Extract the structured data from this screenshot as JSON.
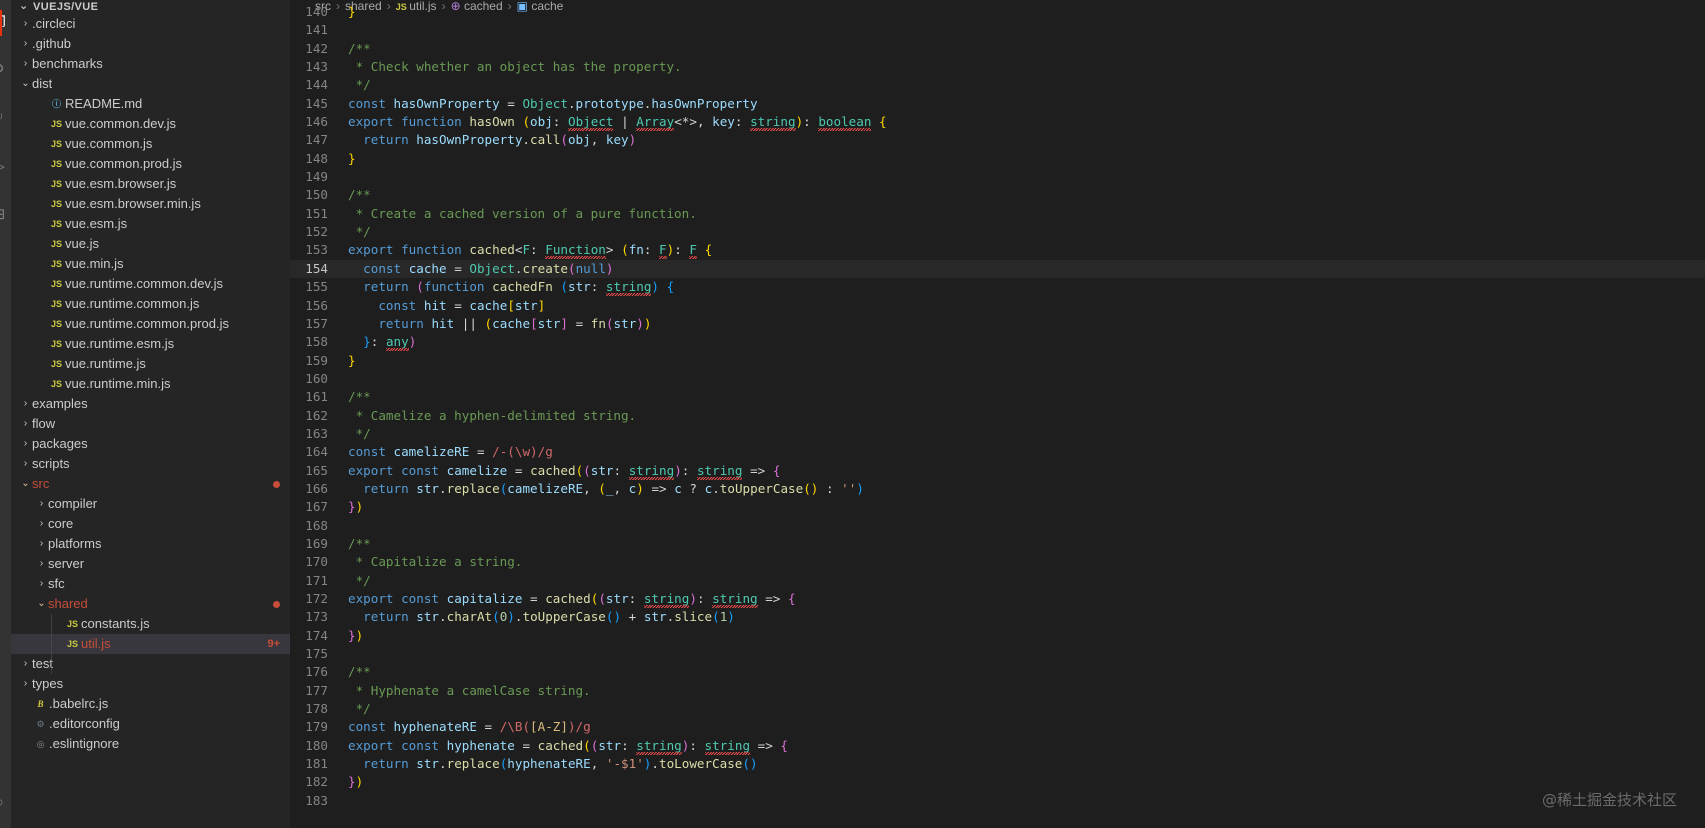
{
  "activity_bar": {
    "items": [
      {
        "name": "explorer-icon",
        "glyph": "❐",
        "active": true
      },
      {
        "name": "search-icon",
        "glyph": "⚲",
        "active": false
      },
      {
        "name": "source-control-icon",
        "glyph": "⑂",
        "active": false
      },
      {
        "name": "run-debug-icon",
        "glyph": "▷",
        "active": false
      },
      {
        "name": "extensions-icon",
        "glyph": "⊞",
        "active": false
      },
      {
        "name": "accounts-icon",
        "glyph": "○",
        "active": false
      }
    ]
  },
  "sidebar": {
    "title": "VUEJS/VUE",
    "title_twisty": "⌄",
    "items": [
      {
        "label": ".circleci",
        "kind": "folder",
        "twisty": "›",
        "indent": 1
      },
      {
        "label": ".github",
        "kind": "folder",
        "twisty": "›",
        "indent": 1
      },
      {
        "label": "benchmarks",
        "kind": "folder",
        "twisty": "›",
        "indent": 1
      },
      {
        "label": "dist",
        "kind": "folder",
        "twisty": "⌄",
        "indent": 1,
        "expanded": true
      },
      {
        "label": "README.md",
        "kind": "md",
        "icon": "ⓘ",
        "indent": 2
      },
      {
        "label": "vue.common.dev.js",
        "kind": "js",
        "icon": "JS",
        "indent": 2
      },
      {
        "label": "vue.common.js",
        "kind": "js",
        "icon": "JS",
        "indent": 2
      },
      {
        "label": "vue.common.prod.js",
        "kind": "js",
        "icon": "JS",
        "indent": 2
      },
      {
        "label": "vue.esm.browser.js",
        "kind": "js",
        "icon": "JS",
        "indent": 2
      },
      {
        "label": "vue.esm.browser.min.js",
        "kind": "js",
        "icon": "JS",
        "indent": 2
      },
      {
        "label": "vue.esm.js",
        "kind": "js",
        "icon": "JS",
        "indent": 2
      },
      {
        "label": "vue.js",
        "kind": "js",
        "icon": "JS",
        "indent": 2
      },
      {
        "label": "vue.min.js",
        "kind": "js",
        "icon": "JS",
        "indent": 2
      },
      {
        "label": "vue.runtime.common.dev.js",
        "kind": "js",
        "icon": "JS",
        "indent": 2
      },
      {
        "label": "vue.runtime.common.js",
        "kind": "js",
        "icon": "JS",
        "indent": 2
      },
      {
        "label": "vue.runtime.common.prod.js",
        "kind": "js",
        "icon": "JS",
        "indent": 2
      },
      {
        "label": "vue.runtime.esm.js",
        "kind": "js",
        "icon": "JS",
        "indent": 2
      },
      {
        "label": "vue.runtime.js",
        "kind": "js",
        "icon": "JS",
        "indent": 2
      },
      {
        "label": "vue.runtime.min.js",
        "kind": "js",
        "icon": "JS",
        "indent": 2
      },
      {
        "label": "examples",
        "kind": "folder",
        "twisty": "›",
        "indent": 1
      },
      {
        "label": "flow",
        "kind": "folder",
        "twisty": "›",
        "indent": 1
      },
      {
        "label": "packages",
        "kind": "folder",
        "twisty": "›",
        "indent": 1
      },
      {
        "label": "scripts",
        "kind": "folder",
        "twisty": "›",
        "indent": 1
      },
      {
        "label": "src",
        "kind": "folder",
        "twisty": "⌄",
        "indent": 1,
        "expanded": true,
        "state": "modified",
        "dot": true
      },
      {
        "label": "compiler",
        "kind": "folder",
        "twisty": "›",
        "indent": 2
      },
      {
        "label": "core",
        "kind": "folder",
        "twisty": "›",
        "indent": 2
      },
      {
        "label": "platforms",
        "kind": "folder",
        "twisty": "›",
        "indent": 2
      },
      {
        "label": "server",
        "kind": "folder",
        "twisty": "›",
        "indent": 2
      },
      {
        "label": "sfc",
        "kind": "folder",
        "twisty": "›",
        "indent": 2
      },
      {
        "label": "shared",
        "kind": "folder",
        "twisty": "⌄",
        "indent": 2,
        "expanded": true,
        "state": "modified",
        "dot": true
      },
      {
        "label": "constants.js",
        "kind": "js",
        "icon": "JS",
        "indent": 3
      },
      {
        "label": "util.js",
        "kind": "js",
        "icon": "JS",
        "indent": 3,
        "selected": true,
        "state": "modified",
        "badge": "9+"
      },
      {
        "label": "test",
        "kind": "folder",
        "twisty": "›",
        "indent": 1
      },
      {
        "label": "types",
        "kind": "folder",
        "twisty": "›",
        "indent": 1
      },
      {
        "label": ".babelrc.js",
        "kind": "babel",
        "icon": "B",
        "indent": 1
      },
      {
        "label": ".editorconfig",
        "kind": "gear",
        "icon": "⚙",
        "indent": 1
      },
      {
        "label": ".eslintignore",
        "kind": "circle",
        "icon": "◎",
        "indent": 1
      }
    ]
  },
  "breadcrumb": {
    "segments": [
      {
        "text": "src",
        "icon": ""
      },
      {
        "text": "shared",
        "icon": ""
      },
      {
        "text": "util.js",
        "icon": "JS"
      },
      {
        "text": "cached",
        "icon": "⊕"
      },
      {
        "text": "cache",
        "icon": "▣"
      }
    ],
    "separator": "›"
  },
  "editor": {
    "first_visible_line": 140,
    "current_line": 154,
    "watermark": "@稀土掘金技术社区",
    "lines": [
      {
        "n": 140,
        "clipped": true,
        "html": "<span class='pu1'>}</span>"
      },
      {
        "n": 141,
        "html": ""
      },
      {
        "n": 142,
        "html": "<span class='cmt'>/**</span>"
      },
      {
        "n": 143,
        "html": "<span class='cmt'> * Check whether an object has the property.</span>"
      },
      {
        "n": 144,
        "html": "<span class='cmt'> */</span>"
      },
      {
        "n": 145,
        "html": "<span class='kw'>const</span> <span class='var'>hasOwnProperty</span> <span class='op'>=</span> <span class='typ'>Object</span><span class='op'>.</span><span class='var'>prototype</span><span class='op'>.</span><span class='var'>hasOwnProperty</span>"
      },
      {
        "n": 146,
        "html": "<span class='kw'>export</span> <span class='kw'>function</span> <span class='fn'>hasOwn</span> <span class='pu1'>(</span><span class='var'>obj</span><span class='op'>:</span> <span class='typ sq'>Object</span> <span class='op'>|</span> <span class='typ sq'>Array</span><span class='op'>&lt;*&gt;</span><span class='op'>,</span> <span class='var'>key</span><span class='op'>:</span> <span class='typ sq'>string</span><span class='pu1'>)</span><span class='op'>:</span> <span class='typ sq'>boolean</span> <span class='pu1'>{</span>"
      },
      {
        "n": 147,
        "html": "  <span class='kw'>return</span> <span class='var'>hasOwnProperty</span><span class='op'>.</span><span class='fn'>call</span><span class='pu2'>(</span><span class='var'>obj</span><span class='op'>,</span> <span class='var'>key</span><span class='pu2'>)</span>"
      },
      {
        "n": 148,
        "html": "<span class='pu1'>}</span>"
      },
      {
        "n": 149,
        "html": ""
      },
      {
        "n": 150,
        "html": "<span class='cmt'>/**</span>"
      },
      {
        "n": 151,
        "html": "<span class='cmt'> * Create a cached version of a pure function.</span>"
      },
      {
        "n": 152,
        "html": "<span class='cmt'> */</span>"
      },
      {
        "n": 153,
        "html": "<span class='kw'>export</span> <span class='kw'>function</span> <span class='fn'>cached</span><span class='op'>&lt;</span><span class='typ'>F</span><span class='op'>:</span> <span class='typ sq'>Function</span><span class='op'>&gt;</span> <span class='pu1'>(</span><span class='var'>fn</span><span class='op'>:</span> <span class='typ sq'>F</span><span class='pu1'>)</span><span class='op'>:</span> <span class='typ sq'>F</span> <span class='pu1'>{</span>"
      },
      {
        "n": 154,
        "current": true,
        "html": "  <span class='kw'>const</span> <span class='var'>cache</span> <span class='op'>=</span> <span class='typ'>Object</span><span class='op'>.</span><span class='fn'>create</span><span class='pu2'>(</span><span class='kw'>null</span><span class='pu2'>)</span>"
      },
      {
        "n": 155,
        "html": "  <span class='kw'>return</span> <span class='pu2'>(</span><span class='kw'>function</span> <span class='fn'>cachedFn</span> <span class='pu3'>(</span><span class='var'>str</span><span class='op'>:</span> <span class='typ sq'>string</span><span class='pu3'>)</span> <span class='pu3'>{</span>"
      },
      {
        "n": 156,
        "html": "    <span class='kw'>const</span> <span class='var'>hit</span> <span class='op'>=</span> <span class='var'>cache</span><span class='pu1'>[</span><span class='var'>str</span><span class='pu1'>]</span>"
      },
      {
        "n": 157,
        "html": "    <span class='kw'>return</span> <span class='var'>hit</span> <span class='op'>||</span> <span class='pu1'>(</span><span class='var'>cache</span><span class='pu2'>[</span><span class='var'>str</span><span class='pu2'>]</span> <span class='op'>=</span> <span class='fn'>fn</span><span class='pu2'>(</span><span class='var'>str</span><span class='pu2'>)</span><span class='pu1'>)</span>"
      },
      {
        "n": 158,
        "html": "  <span class='pu3'>}</span><span class='op'>:</span> <span class='typ sq'>any</span><span class='pu2'>)</span>"
      },
      {
        "n": 159,
        "html": "<span class='pu1'>}</span>"
      },
      {
        "n": 160,
        "html": ""
      },
      {
        "n": 161,
        "html": "<span class='cmt'>/**</span>"
      },
      {
        "n": 162,
        "html": "<span class='cmt'> * Camelize a hyphen-delimited string.</span>"
      },
      {
        "n": 163,
        "html": "<span class='cmt'> */</span>"
      },
      {
        "n": 164,
        "html": "<span class='kw'>const</span> <span class='var'>camelizeRE</span> <span class='op'>=</span> <span class='re'>/-(\\w)/g</span>"
      },
      {
        "n": 165,
        "html": "<span class='kw'>export</span> <span class='kw'>const</span> <span class='var'>camelize</span> <span class='op'>=</span> <span class='fn'>cached</span><span class='pu1'>(</span><span class='pu2'>(</span><span class='var'>str</span><span class='op'>:</span> <span class='typ sq'>string</span><span class='pu2'>)</span><span class='op'>:</span> <span class='typ sq'>string</span> <span class='op'>=&gt;</span> <span class='pu2'>{</span>"
      },
      {
        "n": 166,
        "html": "  <span class='kw'>return</span> <span class='var'>str</span><span class='op'>.</span><span class='fn'>replace</span><span class='pu3'>(</span><span class='var'>camelizeRE</span><span class='op'>,</span> <span class='pu1'>(</span><span class='var'>_</span><span class='op'>,</span> <span class='var'>c</span><span class='pu1'>)</span> <span class='op'>=&gt;</span> <span class='var'>c</span> <span class='op'>?</span> <span class='var'>c</span><span class='op'>.</span><span class='fn'>toUpperCase</span><span class='pu1'>()</span> <span class='op'>:</span> <span class='str'>''</span><span class='pu3'>)</span>"
      },
      {
        "n": 167,
        "html": "<span class='pu2'>}</span><span class='pu1'>)</span>"
      },
      {
        "n": 168,
        "html": ""
      },
      {
        "n": 169,
        "html": "<span class='cmt'>/**</span>"
      },
      {
        "n": 170,
        "html": "<span class='cmt'> * Capitalize a string.</span>"
      },
      {
        "n": 171,
        "html": "<span class='cmt'> */</span>"
      },
      {
        "n": 172,
        "html": "<span class='kw'>export</span> <span class='kw'>const</span> <span class='var'>capitalize</span> <span class='op'>=</span> <span class='fn'>cached</span><span class='pu1'>(</span><span class='pu2'>(</span><span class='var'>str</span><span class='op'>:</span> <span class='typ sq'>string</span><span class='pu2'>)</span><span class='op'>:</span> <span class='typ sq'>string</span> <span class='op'>=&gt;</span> <span class='pu2'>{</span>"
      },
      {
        "n": 173,
        "html": "  <span class='kw'>return</span> <span class='var'>str</span><span class='op'>.</span><span class='fn'>charAt</span><span class='pu3'>(</span><span class='num'>0</span><span class='pu3'>)</span><span class='op'>.</span><span class='fn'>toUpperCase</span><span class='pu3'>()</span> <span class='op'>+</span> <span class='var'>str</span><span class='op'>.</span><span class='fn'>slice</span><span class='pu3'>(</span><span class='num'>1</span><span class='pu3'>)</span>"
      },
      {
        "n": 174,
        "html": "<span class='pu2'>}</span><span class='pu1'>)</span>"
      },
      {
        "n": 175,
        "html": ""
      },
      {
        "n": 176,
        "html": "<span class='cmt'>/**</span>"
      },
      {
        "n": 177,
        "html": "<span class='cmt'> * Hyphenate a camelCase string.</span>"
      },
      {
        "n": 178,
        "html": "<span class='cmt'> */</span>"
      },
      {
        "n": 179,
        "html": "<span class='kw'>const</span> <span class='var'>hyphenateRE</span> <span class='op'>=</span> <span class='re'>/\\B(</span><span class='re2'>[A-Z]</span><span class='re'>)/g</span>"
      },
      {
        "n": 180,
        "html": "<span class='kw'>export</span> <span class='kw'>const</span> <span class='var'>hyphenate</span> <span class='op'>=</span> <span class='fn'>cached</span><span class='pu1'>(</span><span class='pu2'>(</span><span class='var'>str</span><span class='op'>:</span> <span class='typ sq'>string</span><span class='pu2'>)</span><span class='op'>:</span> <span class='typ sq'>string</span> <span class='op'>=&gt;</span> <span class='pu2'>{</span>"
      },
      {
        "n": 181,
        "html": "  <span class='kw'>return</span> <span class='var'>str</span><span class='op'>.</span><span class='fn'>replace</span><span class='pu3'>(</span><span class='var'>hyphenateRE</span><span class='op'>,</span> <span class='str'>'-$1'</span><span class='pu3'>)</span><span class='op'>.</span><span class='fn'>toLowerCase</span><span class='pu3'>()</span>"
      },
      {
        "n": 182,
        "html": "<span class='pu2'>}</span><span class='pu1'>)</span>"
      },
      {
        "n": 183,
        "clipped": true,
        "html": ""
      }
    ]
  },
  "colors": {
    "editor_bg": "#1e1e1e",
    "sidebar_bg": "#252526",
    "activity_bg": "#333333",
    "selection_bg": "#37373d",
    "current_line_bg": "#282828",
    "modified_file": "#e2c08d",
    "deleted_conflict": "#c74e39",
    "accent": "#e7340e"
  }
}
